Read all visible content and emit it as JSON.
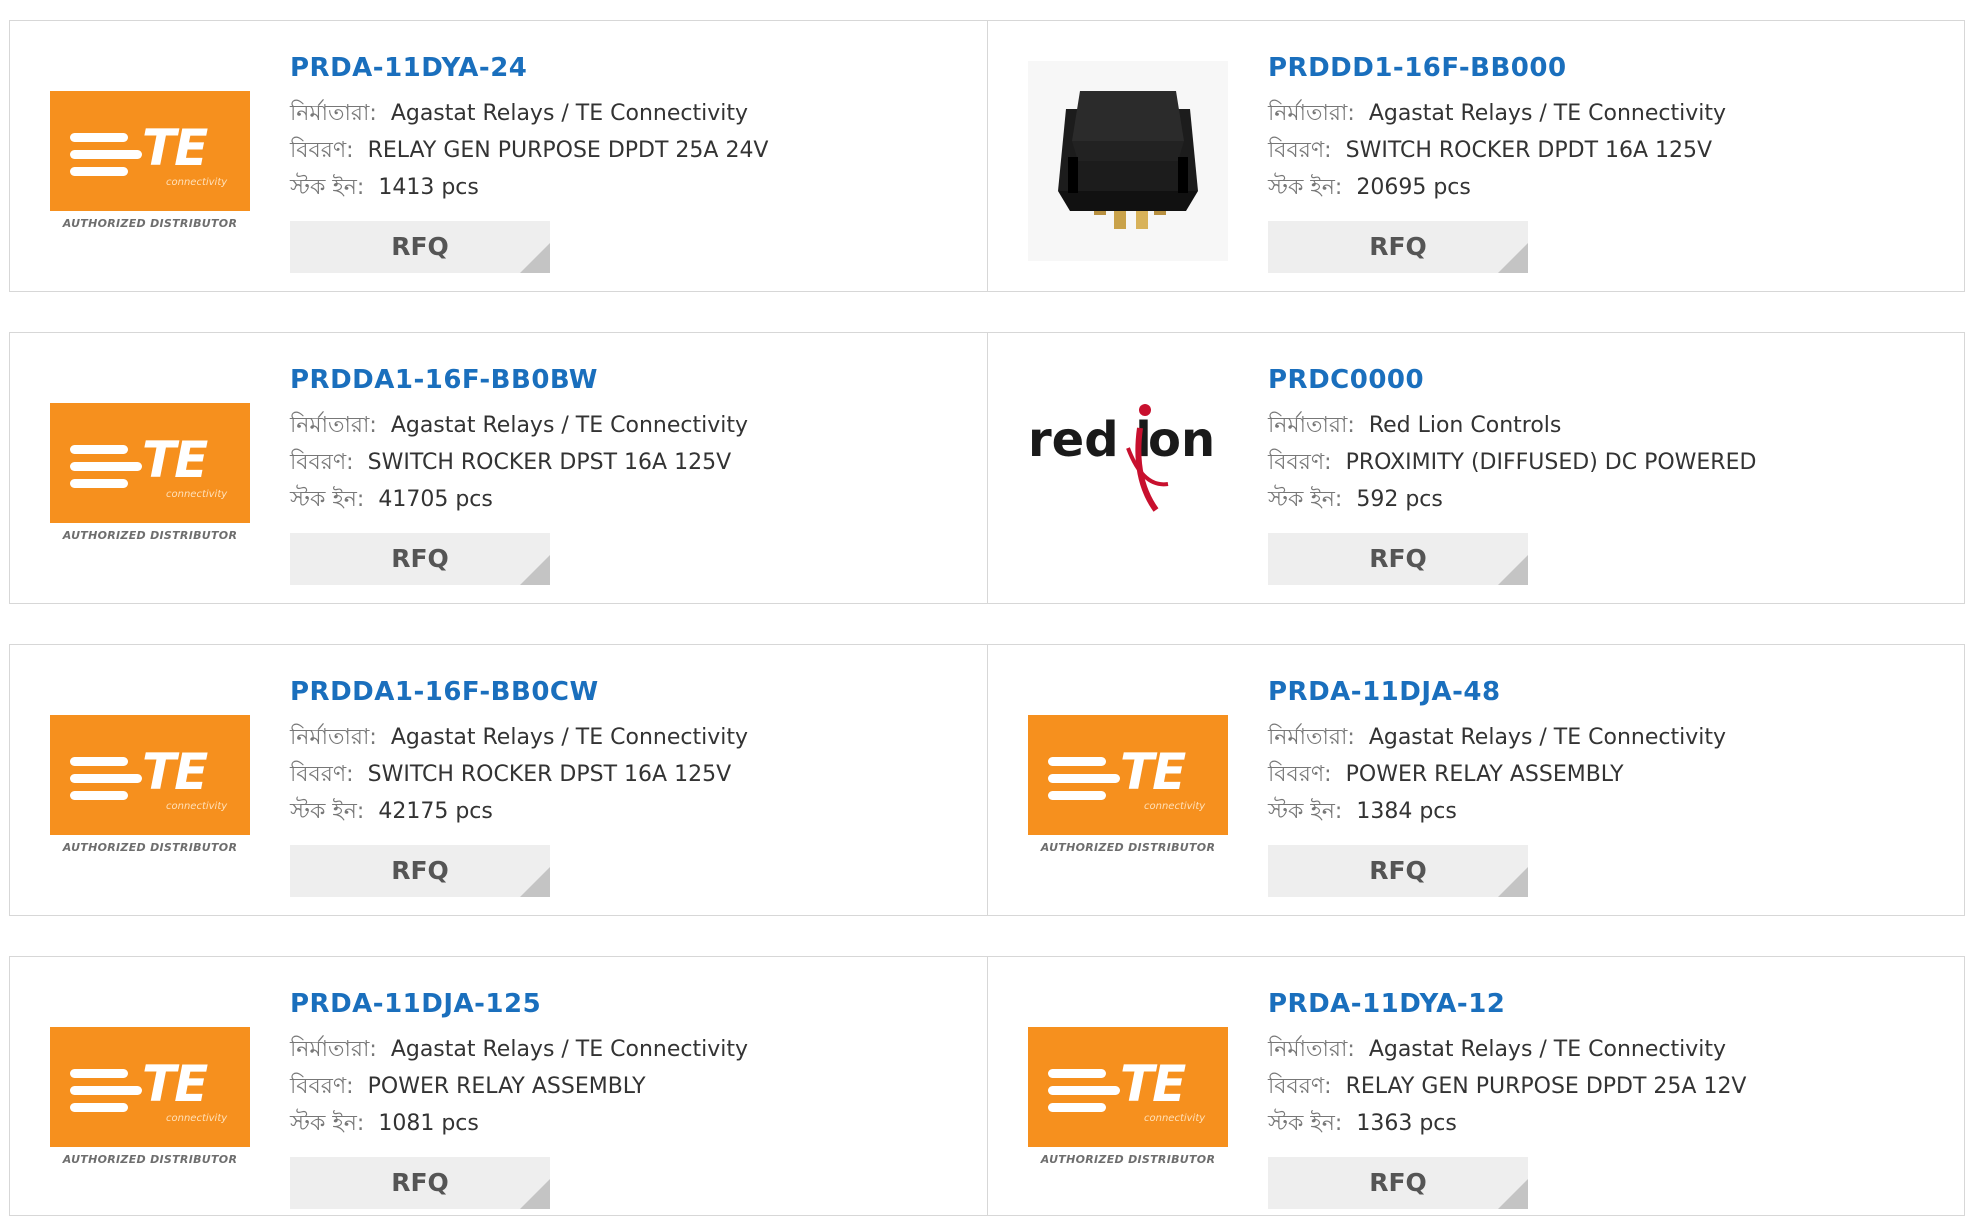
{
  "labels": {
    "manufacturer": "নির্মাতারা:",
    "description": "বিবরণ:",
    "stock": "স্টক ইন:",
    "rfq": "RFQ"
  },
  "logos": {
    "te_text": "TE",
    "te_sub": "connectivity",
    "te_authorized": "AUTHORIZED DISTRIBUTOR",
    "redlion_text_a": "red l",
    "redlion_text_b": "on"
  },
  "colors": {
    "link": "#1a6fbd",
    "te_orange": "#f6901e",
    "redlion_red": "#c8102e"
  },
  "products": [
    {
      "part": "PRDA-11DYA-24",
      "manufacturer": "Agastat Relays / TE Connectivity",
      "description": "RELAY GEN PURPOSE DPDT 25A 24V",
      "stock": "1413 pcs",
      "image": "te-logo"
    },
    {
      "part": "PRDDD1-16F-BB000",
      "manufacturer": "Agastat Relays / TE Connectivity",
      "description": "SWITCH ROCKER DPDT 16A 125V",
      "stock": "20695 pcs",
      "image": "rocker-switch-photo"
    },
    {
      "part": "PRDDA1-16F-BB0BW",
      "manufacturer": "Agastat Relays / TE Connectivity",
      "description": "SWITCH ROCKER DPST 16A 125V",
      "stock": "41705 pcs",
      "image": "te-logo"
    },
    {
      "part": "PRDC0000",
      "manufacturer": "Red Lion Controls",
      "description": "PROXIMITY (DIFFUSED) DC POWERED",
      "stock": "592 pcs",
      "image": "red-lion-logo"
    },
    {
      "part": "PRDDA1-16F-BB0CW",
      "manufacturer": "Agastat Relays / TE Connectivity",
      "description": "SWITCH ROCKER DPST 16A 125V",
      "stock": "42175 pcs",
      "image": "te-logo"
    },
    {
      "part": "PRDA-11DJA-48",
      "manufacturer": "Agastat Relays / TE Connectivity",
      "description": "POWER RELAY ASSEMBLY",
      "stock": "1384 pcs",
      "image": "te-logo"
    },
    {
      "part": "PRDA-11DJA-125",
      "manufacturer": "Agastat Relays / TE Connectivity",
      "description": "POWER RELAY ASSEMBLY",
      "stock": "1081 pcs",
      "image": "te-logo"
    },
    {
      "part": "PRDA-11DYA-12",
      "manufacturer": "Agastat Relays / TE Connectivity",
      "description": "RELAY GEN PURPOSE DPDT 25A 12V",
      "stock": "1363 pcs",
      "image": "te-logo"
    }
  ]
}
